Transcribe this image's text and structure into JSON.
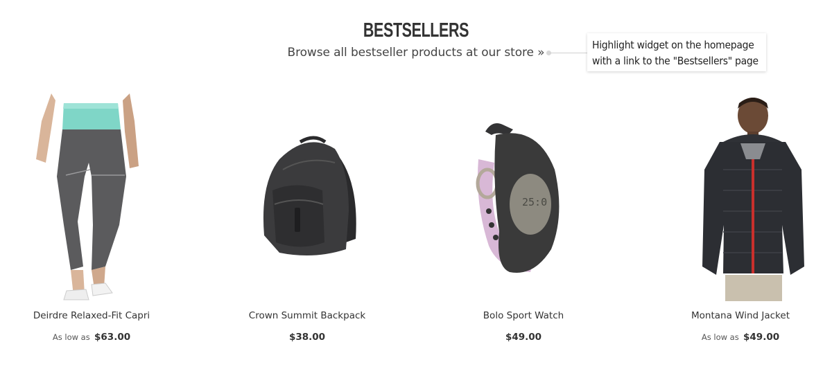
{
  "widget": {
    "title": "BESTSELLERS",
    "browse_link": "Browse all bestseller products at our store »"
  },
  "callout": {
    "line1": "Highlight widget on the homepage",
    "line2": "with a link to the \"Bestsellers\" page"
  },
  "products": [
    {
      "name": "Deirdre Relaxed-Fit Capri",
      "price_prefix": "As low as",
      "price": "$63.00",
      "image": "capri-pants-image"
    },
    {
      "name": "Crown Summit Backpack",
      "price_prefix": "",
      "price": "$38.00",
      "image": "backpack-image"
    },
    {
      "name": "Bolo Sport Watch",
      "price_prefix": "",
      "price": "$49.00",
      "image": "sport-watch-image"
    },
    {
      "name": "Montana Wind Jacket",
      "price_prefix": "As low as",
      "price": "$49.00",
      "image": "wind-jacket-image"
    }
  ]
}
